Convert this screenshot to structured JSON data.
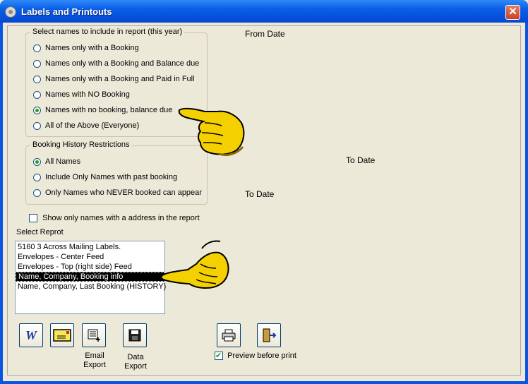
{
  "window": {
    "title": "Labels and Printouts",
    "close_glyph": "✕"
  },
  "names_group": {
    "title": "Select names to include in report (this year)",
    "options": [
      {
        "label": "Names only with a Booking",
        "checked": false
      },
      {
        "label": "Names only with a Booking and Balance due",
        "checked": false
      },
      {
        "label": "Names only with a Booking and Paid in Full",
        "checked": false
      },
      {
        "label": "Names with NO Booking",
        "checked": false
      },
      {
        "label": "Names with no booking, balance due",
        "checked": true
      },
      {
        "label": "All of the Above (Everyone)",
        "checked": false
      }
    ]
  },
  "history_group": {
    "title": "Booking History Restrictions",
    "options": [
      {
        "label": "All Names",
        "checked": true
      },
      {
        "label": "Include Only Names with past booking",
        "checked": false
      },
      {
        "label": "Only Names who NEVER booked can appear",
        "checked": false
      }
    ]
  },
  "dates": {
    "from_label": "From Date",
    "to_label_1": "To Date",
    "to_label_2": "To Date"
  },
  "address_checkbox": {
    "label": "Show only names with a address in the report",
    "checked": false
  },
  "report": {
    "label": "Select Reprot",
    "items": [
      "5160 3 Across Mailing Labels.",
      "Envelopes - Center Feed",
      "Envelopes - Top (right side) Feed",
      "Name, Company, Booking info",
      "Name, Company, Last Booking (HISTORY)"
    ],
    "selected_index": 3
  },
  "buttons": {
    "word_glyph": "W",
    "email_export": "Email\nExport",
    "data_export": "Data\nExport"
  },
  "preview_checkbox": {
    "label": "Preview before print",
    "checked": true
  },
  "colors": {
    "title_bar": "#0a5ee8",
    "window_bg": "#ece9d8",
    "pointer_yellow": "#f5d000",
    "radio_dot": "#21a121"
  }
}
